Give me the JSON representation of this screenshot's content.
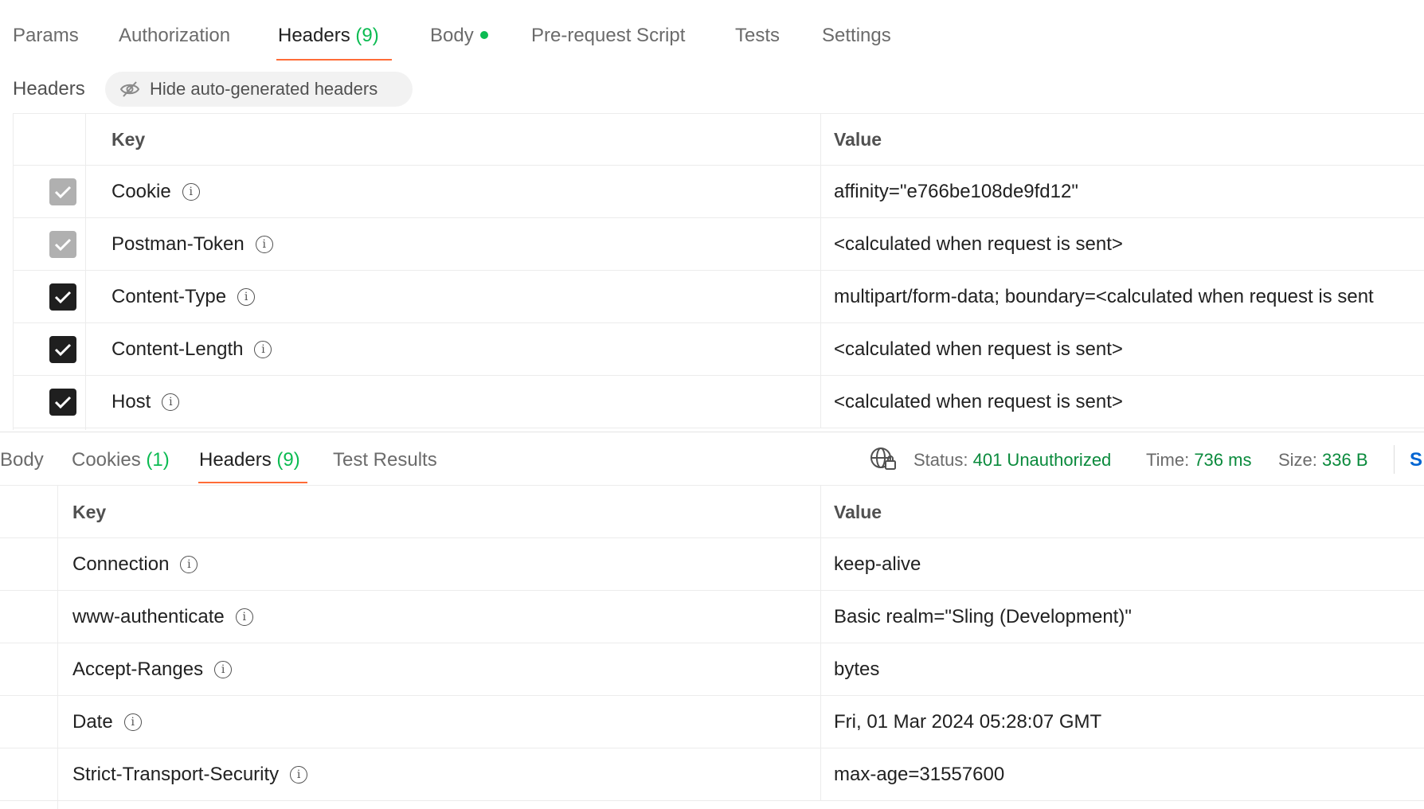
{
  "request_tabs": [
    {
      "label": "Params",
      "count": ""
    },
    {
      "label": "Authorization",
      "count": ""
    },
    {
      "label": "Headers",
      "count": "(9)"
    },
    {
      "label": "Body",
      "count": ""
    },
    {
      "label": "Pre-request Script",
      "count": ""
    },
    {
      "label": "Tests",
      "count": ""
    },
    {
      "label": "Settings",
      "count": ""
    }
  ],
  "active_request_tab": "Headers",
  "headers_section": {
    "label": "Headers",
    "toggle_label": "Hide auto-generated headers"
  },
  "request_headers": {
    "columns": {
      "key": "Key",
      "value": "Value"
    },
    "rows": [
      {
        "key": "Cookie",
        "value": "affinity=\"e766be108de9fd12\"",
        "checked": true,
        "auto": true
      },
      {
        "key": "Postman-Token",
        "value": "<calculated when request is sent>",
        "checked": true,
        "auto": true
      },
      {
        "key": "Content-Type",
        "value": "multipart/form-data; boundary=<calculated when request is sent",
        "checked": true,
        "auto": false
      },
      {
        "key": "Content-Length",
        "value": "<calculated when request is sent>",
        "checked": true,
        "auto": false
      },
      {
        "key": "Host",
        "value": "<calculated when request is sent>",
        "checked": true,
        "auto": false
      }
    ]
  },
  "response_tabs": [
    {
      "label": "Body",
      "count": ""
    },
    {
      "label": "Cookies",
      "count": "(1)"
    },
    {
      "label": "Headers",
      "count": "(9)"
    },
    {
      "label": "Test Results",
      "count": ""
    }
  ],
  "active_response_tab": "Headers",
  "response_status": {
    "status_label": "Status:",
    "status_value": "401 Unauthorized",
    "time_label": "Time:",
    "time_value": "736 ms",
    "size_label": "Size:",
    "size_value": "336 B",
    "save_label": "S"
  },
  "response_headers": {
    "columns": {
      "key": "Key",
      "value": "Value"
    },
    "rows": [
      {
        "key": "Connection",
        "value": "keep-alive"
      },
      {
        "key": "www-authenticate",
        "value": "Basic realm=\"Sling (Development)\""
      },
      {
        "key": "Accept-Ranges",
        "value": "bytes"
      },
      {
        "key": "Date",
        "value": "Fri, 01 Mar 2024 05:28:07 GMT"
      },
      {
        "key": "Strict-Transport-Security",
        "value": "max-age=31557600"
      }
    ]
  },
  "colors": {
    "accent_underline": "#ff6c37",
    "count_green": "#0cbb52",
    "status_green": "#0a8a3c",
    "link_blue": "#0265d2"
  },
  "icons": {
    "info": "info-icon",
    "hide": "eye-slash-icon",
    "globe": "globe-lock-icon",
    "check": "checkmark-icon"
  }
}
